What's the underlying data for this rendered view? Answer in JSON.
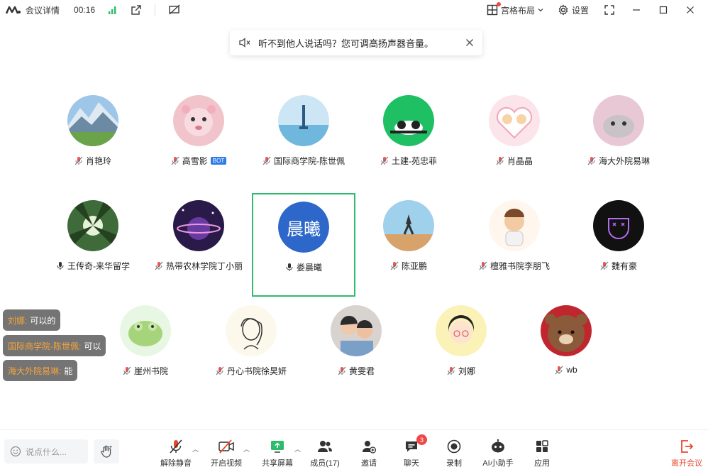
{
  "titlebar": {
    "title": "会议详情",
    "time": "00:16",
    "layout_label": "宫格布局",
    "settings_label": "设置"
  },
  "notice": {
    "text": "听不到他人说话吗？您可调高扬声器音量。"
  },
  "participants": [
    {
      "name": "肖艳玲",
      "mic": "muted"
    },
    {
      "name": "高雪影",
      "mic": "muted",
      "badge": "BOT"
    },
    {
      "name": "国际商学院-陈世佩",
      "mic": "muted"
    },
    {
      "name": "土建-苑忠菲",
      "mic": "muted"
    },
    {
      "name": "肖晶晶",
      "mic": "muted"
    },
    {
      "name": "海大外院易琳",
      "mic": "muted"
    },
    {
      "name": "王传奇-来华留学",
      "mic": "on"
    },
    {
      "name": "热带农林学院丁小丽",
      "mic": "muted"
    },
    {
      "name": "娄晨曦",
      "mic": "on",
      "avatar_text": "晨曦",
      "active": true
    },
    {
      "name": "陈亚鹏",
      "mic": "muted"
    },
    {
      "name": "檀雅书院李朋飞",
      "mic": "muted"
    },
    {
      "name": "魏有豪",
      "mic": "muted"
    },
    {
      "name": "崖州书院",
      "mic": "muted"
    },
    {
      "name": "丹心书院徐昊妍",
      "mic": "muted"
    },
    {
      "name": "黄雯君",
      "mic": "muted"
    },
    {
      "name": "刘娜",
      "mic": "muted"
    },
    {
      "name": "wb",
      "mic": "muted"
    }
  ],
  "chat": [
    {
      "sender": "刘娜:",
      "text": "可以的"
    },
    {
      "sender": "国际商学院-陈世佩:",
      "text": "可以"
    },
    {
      "sender": "海大外院易琳:",
      "text": "能"
    }
  ],
  "toolbar": {
    "say_placeholder": "说点什么...",
    "unmute": "解除静音",
    "video": "开启视频",
    "share": "共享屏幕",
    "members": "成员(17)",
    "invite": "邀请",
    "chat": "聊天",
    "chat_badge": "3",
    "record": "录制",
    "ai": "AI小助手",
    "apps": "应用",
    "leave": "离开会议"
  },
  "colors": {
    "accent_green": "#2dbb6e",
    "leave_red": "#e8472e",
    "badge_red": "#f04848",
    "chat_sender": "#f6a43b"
  }
}
